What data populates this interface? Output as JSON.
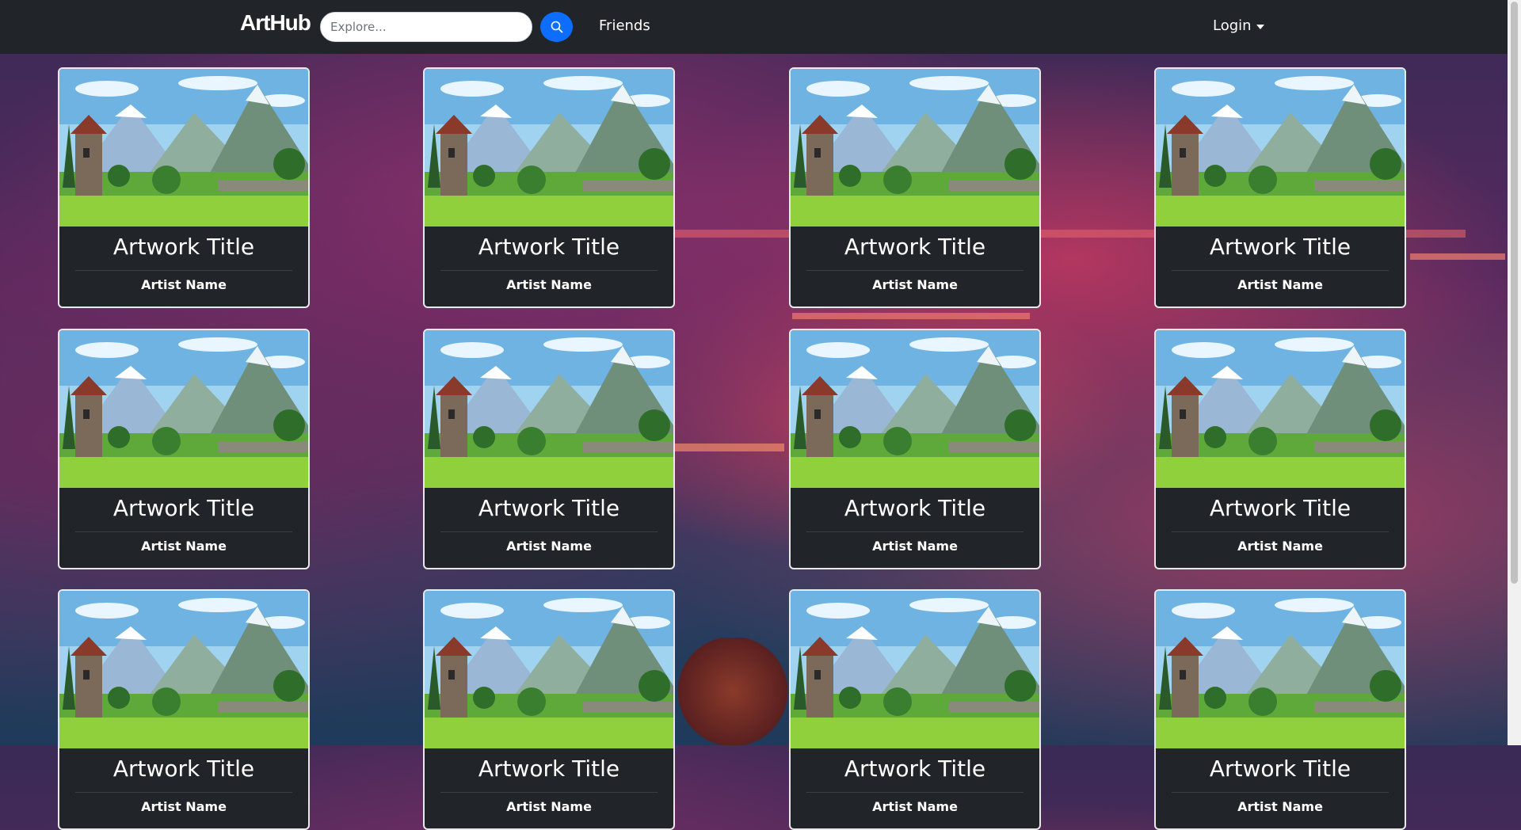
{
  "navbar": {
    "brand": "ArtHub",
    "search_placeholder": "Explore...",
    "search_icon": "search-icon",
    "friends_label": "Friends",
    "login_label": "Login"
  },
  "cards": [
    {
      "title": "Artwork Title",
      "artist": "Artist Name"
    },
    {
      "title": "Artwork Title",
      "artist": "Artist Name"
    },
    {
      "title": "Artwork Title",
      "artist": "Artist Name"
    },
    {
      "title": "Artwork Title",
      "artist": "Artist Name"
    },
    {
      "title": "Artwork Title",
      "artist": "Artist Name"
    },
    {
      "title": "Artwork Title",
      "artist": "Artist Name"
    },
    {
      "title": "Artwork Title",
      "artist": "Artist Name"
    },
    {
      "title": "Artwork Title",
      "artist": "Artist Name"
    },
    {
      "title": "Artwork Title",
      "artist": "Artist Name"
    },
    {
      "title": "Artwork Title",
      "artist": "Artist Name"
    },
    {
      "title": "Artwork Title",
      "artist": "Artist Name"
    },
    {
      "title": "Artwork Title",
      "artist": "Artist Name"
    }
  ],
  "colors": {
    "navbar": "#212529",
    "accent": "#0d6efd",
    "card": "#212529"
  }
}
